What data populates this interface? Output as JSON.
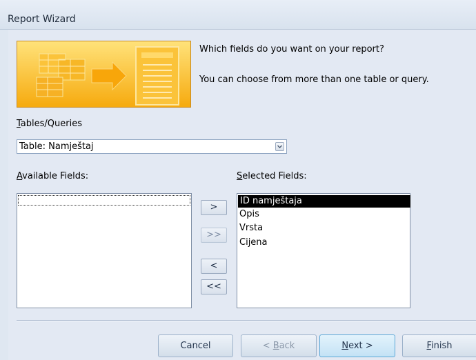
{
  "window": {
    "title": "Report Wizard"
  },
  "intro": {
    "question": "Which fields do you want on your report?",
    "hint": "You can choose from more than one table or query."
  },
  "tables_queries": {
    "label_mnemonic": "T",
    "label_rest": "ables/Queries",
    "selected": "Table: Namještaj"
  },
  "available": {
    "label_mnemonic": "A",
    "label_rest": "vailable Fields:",
    "items": []
  },
  "selected_fields": {
    "label_mnemonic": "S",
    "label_rest": "elected Fields:",
    "items": [
      "ID namještaja",
      "Opis",
      "Vrsta",
      "Cijena"
    ],
    "highlighted_index": 0
  },
  "move_buttons": {
    "add_one": ">",
    "add_all": ">>",
    "remove_one": "<",
    "remove_all": "<<"
  },
  "footer": {
    "cancel": "Cancel",
    "back_prefix": "< ",
    "back_mnemonic": "B",
    "back_rest": "ack",
    "next_mnemonic": "N",
    "next_rest": "ext >",
    "finish_mnemonic": "F",
    "finish_rest": "inish"
  },
  "colors": {
    "banner": "#f7b21d",
    "selection": "#000000",
    "window_bg": "#e3e9f3"
  },
  "icons": [
    "report-wizard-banner-graphic",
    "combo-dropdown-icon"
  ]
}
